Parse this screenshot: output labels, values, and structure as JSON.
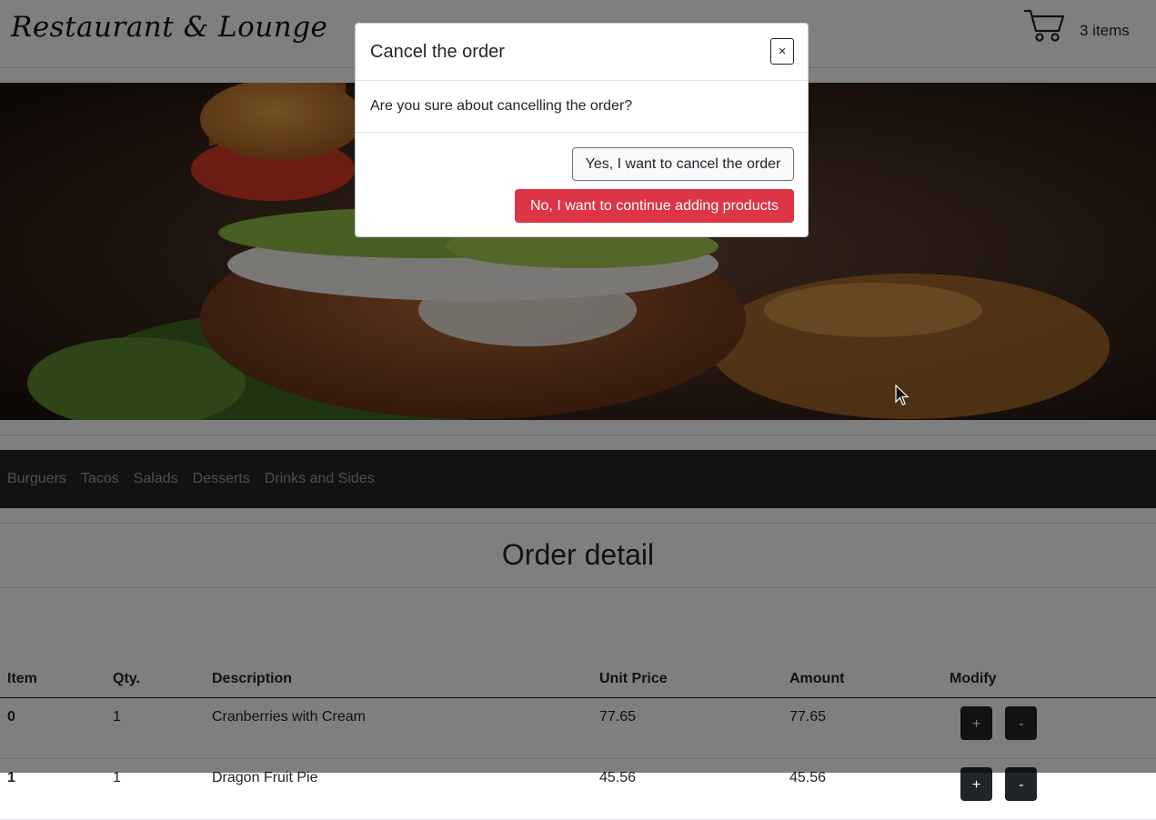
{
  "header": {
    "brand": "Restaurant & Lounge",
    "cart_count": "3 items",
    "cart_icon": "shopping-cart-icon"
  },
  "hero": {
    "image": "burger-photo"
  },
  "categories": [
    "Burguers",
    "Tacos",
    "Salads",
    "Desserts",
    "Drinks and Sides"
  ],
  "order": {
    "title": "Order detail",
    "columns": [
      "Item",
      "Qty.",
      "Description",
      "Unit Price",
      "Amount",
      "Modify"
    ],
    "rows": [
      {
        "item": "0",
        "qty": "1",
        "description": "Cranberries with Cream",
        "unit_price": "77.65",
        "amount": "77.65"
      },
      {
        "item": "1",
        "qty": "1",
        "description": "Dragon Fruit Pie",
        "unit_price": "45.56",
        "amount": "45.56"
      }
    ],
    "plus_label": "+",
    "minus_label": "-"
  },
  "modal": {
    "title": "Cancel the order",
    "close_label": "×",
    "message": "Are you sure about cancelling the order?",
    "confirm_label": "Yes, I want to cancel the order",
    "dismiss_label": "No, I want to continue adding products"
  },
  "colors": {
    "danger": "#dc3545",
    "dark": "#212529",
    "backdrop": "rgba(0,0,0,0.5)"
  }
}
